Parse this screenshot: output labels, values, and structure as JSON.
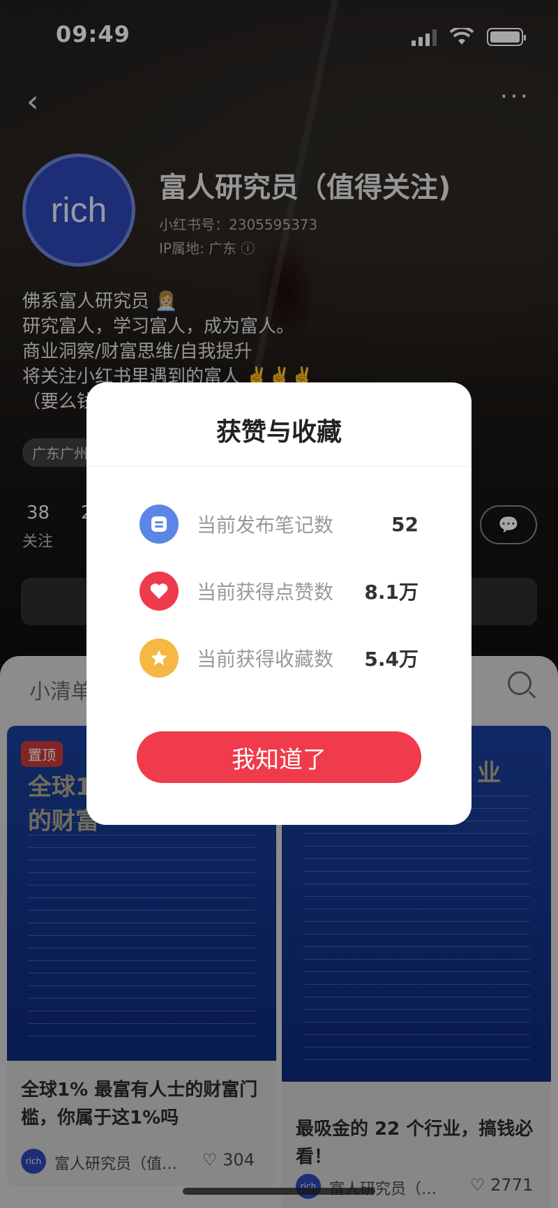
{
  "status_bar": {
    "time": "09:49"
  },
  "profile": {
    "avatar_text": "rich",
    "nickname": "富人研究员（值得关注)",
    "user_id": "小红书号：2305595373",
    "ip_location": "IP属地: 广东 ⓘ",
    "bio_lines": [
      "佛系富人研究员 👩🏼‍💼",
      "研究富人，学习富人，成为富人。",
      "商业洞察/财富思维/自我提升",
      "将关注小红书里遇到的富人 ✌️✌️✌️",
      "（要么钱"
    ],
    "tag": "广东广州",
    "stats": [
      {
        "num": "38",
        "label": "关注"
      },
      {
        "num": "2",
        "label": ""
      }
    ]
  },
  "feed": {
    "tab_title": "小清单",
    "cards": [
      {
        "pin_badge": "置顶",
        "cover_title": "全球1%\n的财富",
        "title": "全球1% 最富有人士的财富门槛，你属于这1%吗",
        "author": "富人研究员（值…",
        "likes": "304"
      },
      {
        "cover_title": "业",
        "title": "最吸金的 22 个行业，搞钱必看！",
        "author": "富人研究员（…",
        "likes": "2771"
      }
    ]
  },
  "modal": {
    "title": "获赞与收藏",
    "rows": [
      {
        "label": "当前发布笔记数",
        "value": "52",
        "icon": "note-icon",
        "color": "#5b86e5"
      },
      {
        "label": "当前获得点赞数",
        "value": "8.1万",
        "icon": "heart-icon",
        "color": "#ee3b4c"
      },
      {
        "label": "当前获得收藏数",
        "value": "5.4万",
        "icon": "star-icon",
        "color": "#f5b843"
      }
    ],
    "button": "我知道了"
  }
}
